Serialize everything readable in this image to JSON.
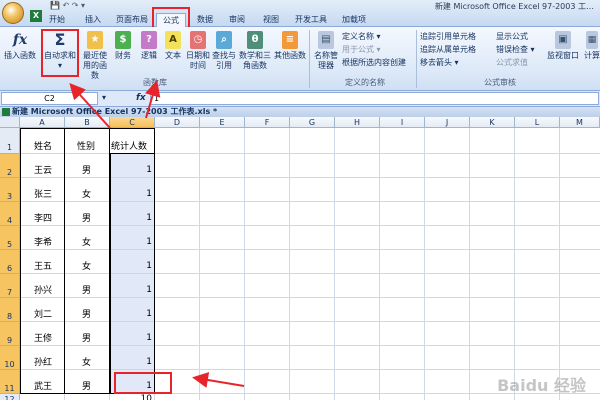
{
  "window_title": "新建 Microsoft Office Excel 97-2003 工…",
  "tabs": [
    {
      "label": "开始"
    },
    {
      "label": "插入"
    },
    {
      "label": "页面布局"
    },
    {
      "label": "公式"
    },
    {
      "label": "数据"
    },
    {
      "label": "审阅"
    },
    {
      "label": "视图"
    },
    {
      "label": "开发工具"
    },
    {
      "label": "加载项"
    }
  ],
  "active_tab": "公式",
  "ribbon": {
    "function_library": {
      "group_label": "函数库",
      "buttons": [
        {
          "label": "插入函数",
          "icon": "fx-icon",
          "glyph": "fx"
        },
        {
          "label": "自动求和",
          "icon": "sigma-icon",
          "glyph": "Σ"
        },
        {
          "label": "最近使用的函数",
          "icon": "book-recent-icon",
          "glyph": "★"
        },
        {
          "label": "财务",
          "icon": "book-finance-icon",
          "glyph": "$"
        },
        {
          "label": "逻辑",
          "icon": "book-logic-icon",
          "glyph": "?"
        },
        {
          "label": "文本",
          "icon": "book-text-icon",
          "glyph": "A"
        },
        {
          "label": "日期和时间",
          "icon": "book-datetime-icon",
          "glyph": "◷"
        },
        {
          "label": "查找与引用",
          "icon": "book-lookup-icon",
          "glyph": "⌕"
        },
        {
          "label": "数学和三角函数",
          "icon": "book-math-icon",
          "glyph": "θ"
        },
        {
          "label": "其他函数",
          "icon": "book-more-icon",
          "glyph": "≡"
        }
      ]
    },
    "defined_names": {
      "group_label": "定义的名称",
      "name_manager": "名称管理器",
      "define_name": "定义名称 ▾",
      "use_in_formula": "用于公式 ▾",
      "create_from_selection": "根据所选内容创建"
    },
    "formula_auditing": {
      "group_label": "公式审核",
      "trace_precedents": "追踪引用单元格",
      "trace_dependents": "追踪从属单元格",
      "remove_arrows": "移去箭头 ▾",
      "show_formulas": "显示公式",
      "error_checking": "错误检查 ▾",
      "evaluate_formula": "公式求值",
      "watch_window": "监视窗口",
      "calc": "计算"
    }
  },
  "formula_bar": {
    "name_box": "C2",
    "fx_label": "fx",
    "value": "1"
  },
  "workbook_title": "新建 Microsoft Office Excel 97-2003 工作表.xls *",
  "columns": [
    "A",
    "B",
    "C",
    "D",
    "E",
    "F",
    "G",
    "H",
    "I",
    "J",
    "K",
    "L",
    "M"
  ],
  "rows": [
    "1",
    "2",
    "3",
    "4",
    "5",
    "6",
    "7",
    "8",
    "9",
    "10",
    "11",
    "12"
  ],
  "table": {
    "headers": [
      "姓名",
      "性别",
      "统计人数"
    ],
    "records": [
      {
        "name": "王云",
        "gender": "男",
        "count": "1"
      },
      {
        "name": "张三",
        "gender": "女",
        "count": "1"
      },
      {
        "name": "李四",
        "gender": "男",
        "count": "1"
      },
      {
        "name": "李希",
        "gender": "女",
        "count": "1"
      },
      {
        "name": "王五",
        "gender": "女",
        "count": "1"
      },
      {
        "name": "孙兴",
        "gender": "男",
        "count": "1"
      },
      {
        "name": "刘二",
        "gender": "男",
        "count": "1"
      },
      {
        "name": "王修",
        "gender": "男",
        "count": "1"
      },
      {
        "name": "孙红",
        "gender": "女",
        "count": "1"
      },
      {
        "name": "武王",
        "gender": "男",
        "count": "1"
      }
    ],
    "total": "10"
  },
  "watermark": "Baidu 经验",
  "accent_colors": {
    "annotation_red": "#e8242b",
    "selected_header": "#f6c461",
    "ribbon_blue": "#dde9f8"
  }
}
